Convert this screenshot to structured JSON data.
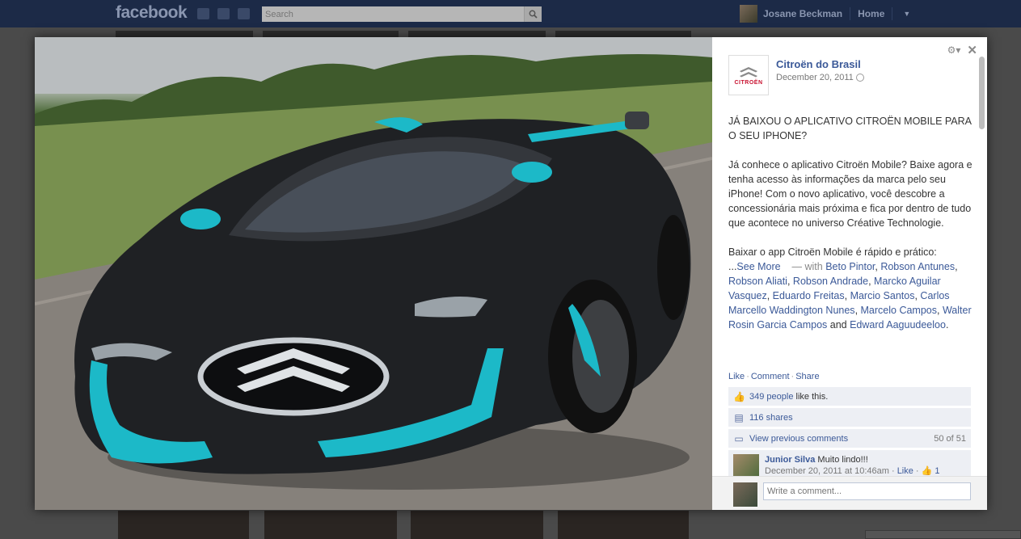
{
  "topbar": {
    "logo": "facebook",
    "search_placeholder": "Search",
    "user_name": "Josane Beckman",
    "home_label": "Home"
  },
  "viewer": {
    "owner_name": "Citroën do Brasil",
    "owner_logo_text": "CITROËN",
    "date": "December 20, 2011",
    "caption": {
      "p1": "JÁ BAIXOU O APLICATIVO CITROËN MOBILE PARA O SEU IPHONE?",
      "p2": "Já conhece o aplicativo Citroën Mobile? Baixe agora e tenha acesso às informações da marca pelo seu iPhone! Com o novo aplicativo, você descobre a concessionária mais próxima e fica por dentro de tudo que acontece no universo Créative Technologie.",
      "p3": "Baixar o app Citroën Mobile é rápido e prático:",
      "ellipsis": "...",
      "see_more": "See More",
      "with_prefix": "— with",
      "tags": [
        "Beto Pintor",
        "Robson Antunes",
        "Robson Aliati",
        "Robson Andrade",
        "Marcko Aguilar Vasquez",
        "Eduardo Freitas",
        "Marcio Santos",
        "Carlos Marcello Waddington Nunes",
        "Marcelo Campos",
        "Walter Rosin Garcia Campos",
        "Edward Aaguudeeloo"
      ],
      "and_word": "and"
    },
    "actions": {
      "like": "Like",
      "comment": "Comment",
      "share": "Share"
    },
    "likes": {
      "count_text": "349 people",
      "suffix": "like this."
    },
    "shares": "116 shares",
    "view_previous": "View previous comments",
    "comment_count": "50 of 51",
    "comment": {
      "author": "Junior Silva",
      "text": "Muito lindo!!!",
      "time": "December 20, 2011 at 10:46am",
      "like": "Like",
      "likes": "1"
    },
    "compose_placeholder": "Write a comment..."
  }
}
